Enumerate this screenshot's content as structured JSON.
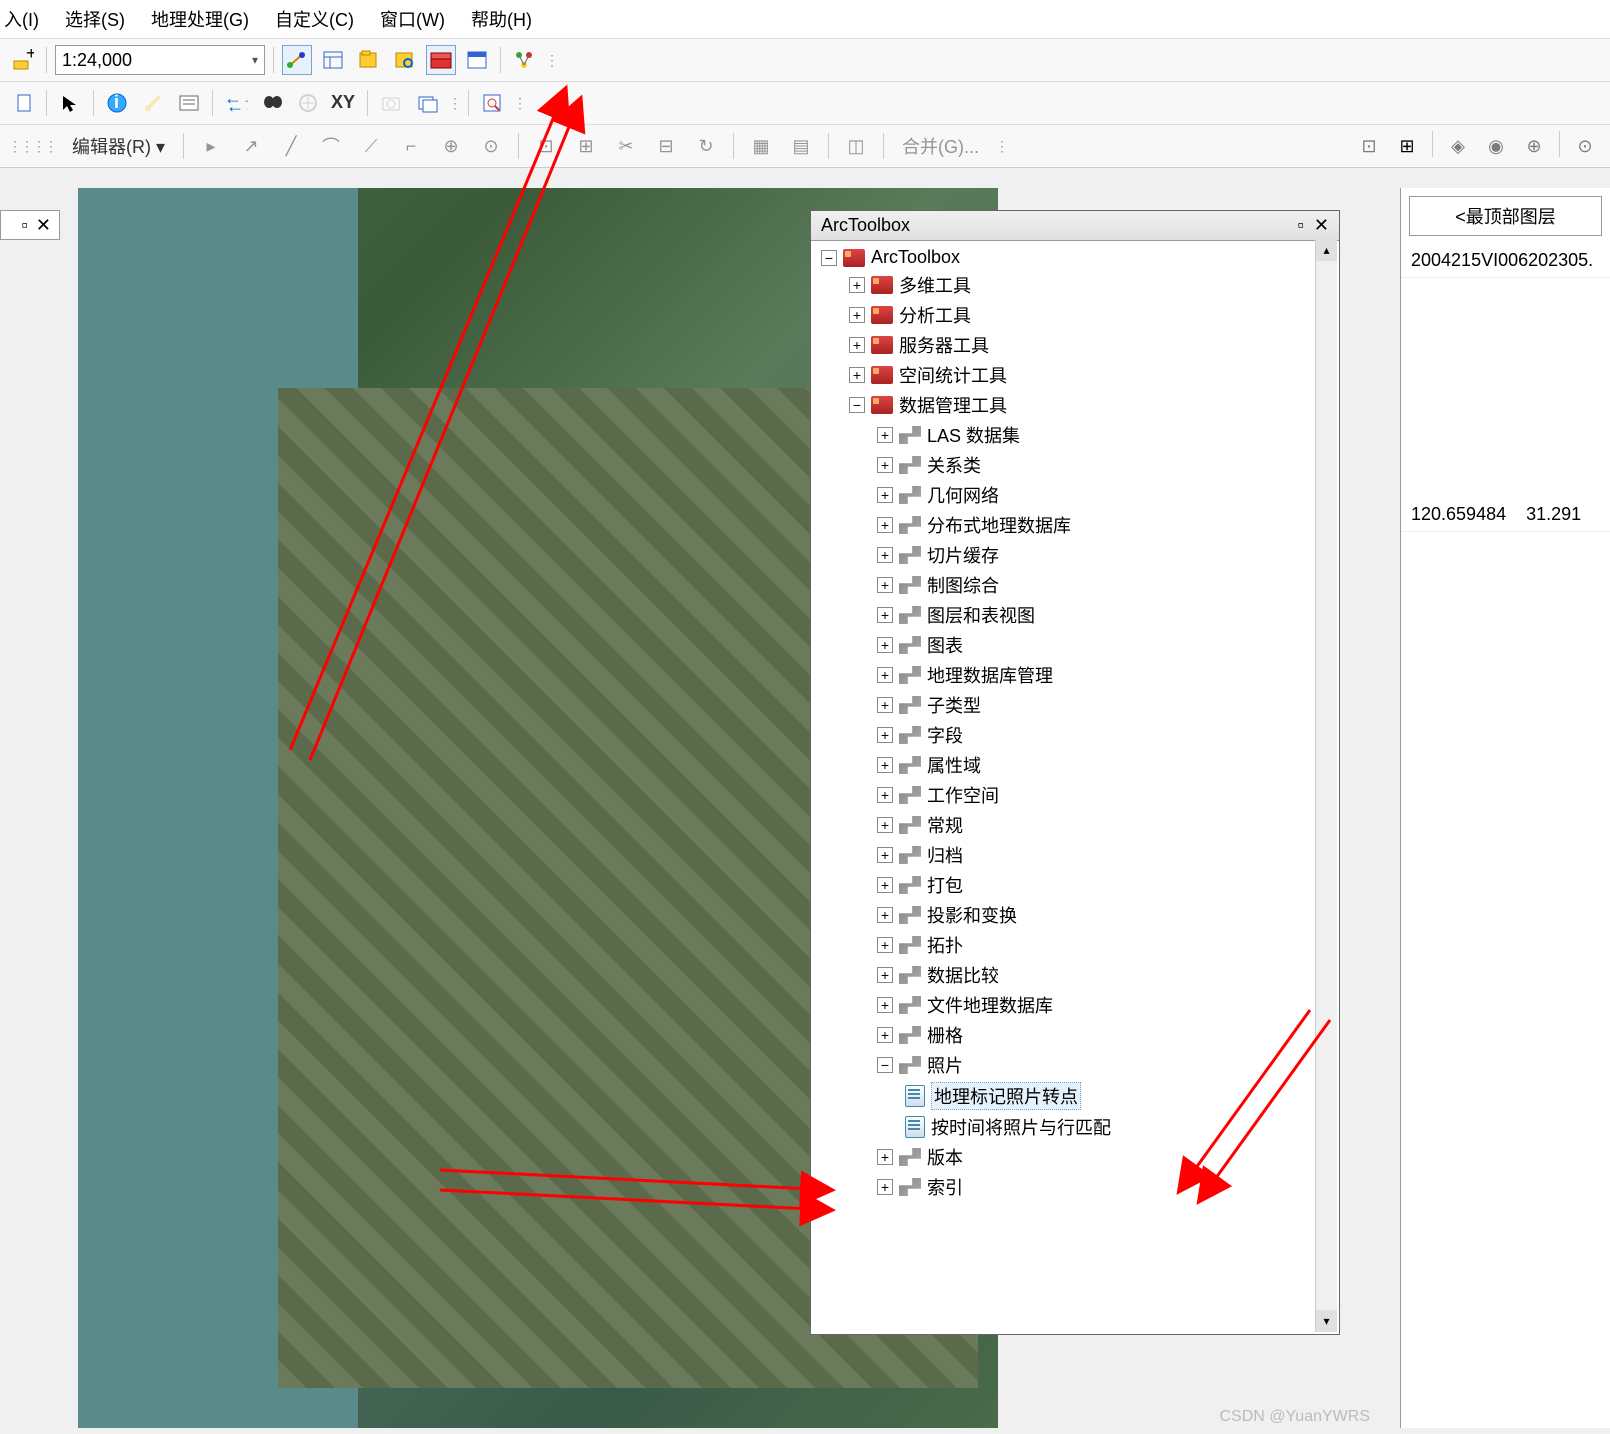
{
  "menu": {
    "insert": "入(I)",
    "select": "选择(S)",
    "geoprocessing": "地理处理(G)",
    "customize": "自定义(C)",
    "window": "窗口(W)",
    "help": "帮助(H)"
  },
  "scale": "1:24,000",
  "editor_label": "编辑器(R) ▾",
  "merge_label": "合并(G)...",
  "toc": {
    "pin": "▫",
    "close": "✕"
  },
  "arctoolbox": {
    "title": "ArcToolbox",
    "root": "ArcToolbox",
    "items_top": [
      "多维工具",
      "分析工具",
      "服务器工具",
      "空间统计工具"
    ],
    "data_mgmt": "数据管理工具",
    "children": [
      "LAS 数据集",
      "关系类",
      "几何网络",
      "分布式地理数据库",
      "切片缓存",
      "制图综合",
      "图层和表视图",
      "图表",
      "地理数据库管理",
      "子类型",
      "字段",
      "属性域",
      "工作空间",
      "常规",
      "归档",
      "打包",
      "投影和变换",
      "拓扑",
      "数据比较",
      "文件地理数据库",
      "栅格"
    ],
    "photos": "照片",
    "photo_tools": [
      "地理标记照片转点",
      "按时间将照片与行匹配"
    ],
    "tail": [
      "版本",
      "索引"
    ]
  },
  "right": {
    "top_layer": "<最顶部图层",
    "id": "2004215VI006202305.",
    "coords_x": "120.659484",
    "coords_y": "31.291"
  },
  "watermark": "CSDN @YuanYWRS"
}
